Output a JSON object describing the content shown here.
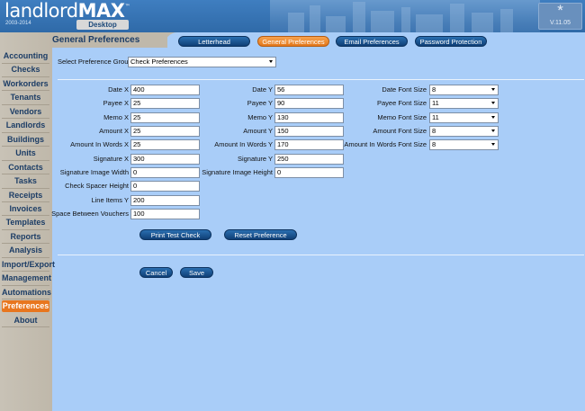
{
  "header": {
    "logo_light": "landlord",
    "logo_bold": "MAX",
    "logo_tm": "™",
    "years": "2003-2014",
    "edition": "Desktop",
    "version_icon": "asterisk-icon",
    "version_star": "*",
    "version": "V.11.05"
  },
  "sidebar": {
    "items": [
      {
        "label": "Accounting"
      },
      {
        "label": "Checks"
      },
      {
        "label": "Workorders"
      },
      {
        "label": "Tenants"
      },
      {
        "label": "Vendors"
      },
      {
        "label": "Landlords"
      },
      {
        "label": "Buildings"
      },
      {
        "label": "Units"
      },
      {
        "label": "Contacts"
      },
      {
        "label": "Tasks"
      },
      {
        "label": "Receipts"
      },
      {
        "label": "Invoices"
      },
      {
        "label": "Templates"
      },
      {
        "label": "Reports"
      },
      {
        "label": "Analysis"
      },
      {
        "label": "Import/Export"
      },
      {
        "label": "Management"
      },
      {
        "label": "Automations"
      },
      {
        "label": "Preferences",
        "active": true
      },
      {
        "label": "About"
      }
    ]
  },
  "page": {
    "title": "General Preferences",
    "tabs": [
      {
        "label": "Letterhead"
      },
      {
        "label": "General Preferences",
        "active": true
      },
      {
        "label": "Email Preferences"
      },
      {
        "label": "Password Protection"
      }
    ]
  },
  "form": {
    "group_label": "Select Preference Group",
    "group_value": "Check Preferences",
    "col1": [
      {
        "label": "Date X",
        "value": "400"
      },
      {
        "label": "Payee X",
        "value": "25"
      },
      {
        "label": "Memo X",
        "value": "25"
      },
      {
        "label": "Amount X",
        "value": "25"
      },
      {
        "label": "Amount In Words X",
        "value": "25"
      },
      {
        "label": "Signature X",
        "value": "300"
      },
      {
        "label": "Signature Image Width",
        "value": "0"
      },
      {
        "label": "Check Spacer Height",
        "value": "0"
      },
      {
        "label": "Line Items Y",
        "value": "200"
      },
      {
        "label": "Space Between Vouchers",
        "value": "100"
      }
    ],
    "col2": [
      {
        "label": "Date Y",
        "value": "56"
      },
      {
        "label": "Payee Y",
        "value": "90"
      },
      {
        "label": "Memo Y",
        "value": "130"
      },
      {
        "label": "Amount Y",
        "value": "150"
      },
      {
        "label": "Amount In Words Y",
        "value": "170"
      },
      {
        "label": "Signature Y",
        "value": "250"
      },
      {
        "label": "Signature Image Height",
        "value": "0"
      }
    ],
    "col3": [
      {
        "label": "Date Font Size",
        "value": "8"
      },
      {
        "label": "Payee Font Size",
        "value": "11"
      },
      {
        "label": "Memo Font Size",
        "value": "11"
      },
      {
        "label": "Amount Font Size",
        "value": "8"
      },
      {
        "label": "Amount In Words Font Size",
        "value": "8"
      }
    ],
    "print_test_label": "Print Test Check",
    "reset_label": "Reset Preference",
    "cancel_label": "Cancel",
    "save_label": "Save"
  }
}
